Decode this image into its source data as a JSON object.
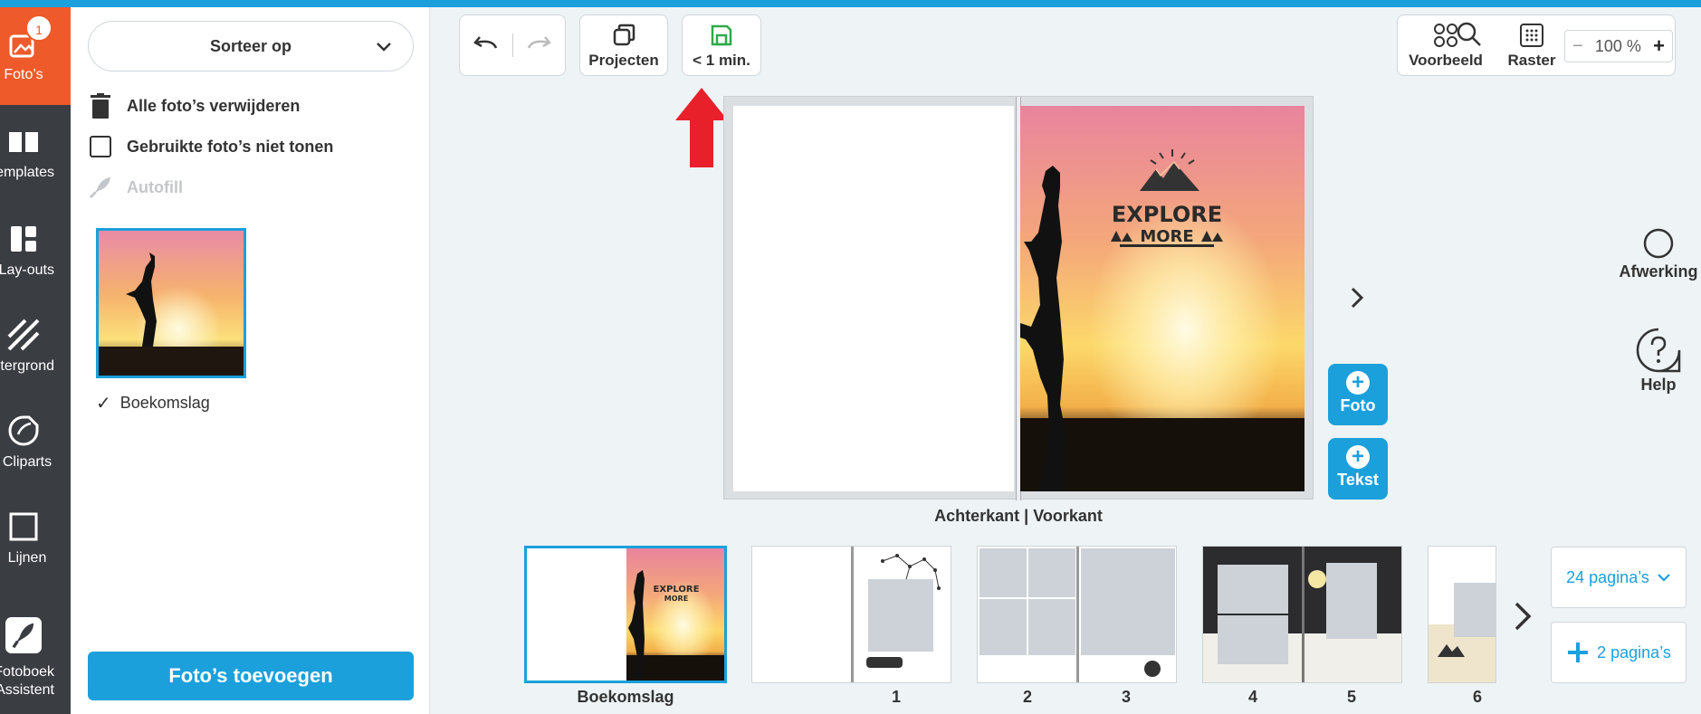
{
  "rail": {
    "items": [
      {
        "label": "Foto’s",
        "badge": "1"
      },
      {
        "label": "Templates"
      },
      {
        "label": "Lay-outs"
      },
      {
        "label": "Achtergrond"
      },
      {
        "label": "Cliparts"
      },
      {
        "label": "Lijnen"
      },
      {
        "label": "Fotoboek",
        "label2": "Assistent"
      }
    ]
  },
  "panel": {
    "sort_label": "Sorteer op",
    "delete_all": "Alle foto’s verwijderen",
    "hide_used": "Gebruikte foto’s niet tonen",
    "autofill": "Autofill",
    "photo_caption": "Boekomslag",
    "add_photos": "Foto’s toevoegen"
  },
  "toolbar": {
    "projects": "Projecten",
    "save_status": "< 1 min.",
    "preview": "Voorbeeld",
    "grid": "Raster",
    "zoom_minus": "−",
    "zoom": "100 %",
    "zoom_plus": "+"
  },
  "canvas": {
    "spread_label": "Achterkant | Voorkant",
    "cover_text_1": "EXPLORE",
    "cover_text_2": "MORE",
    "add_photo": "Foto",
    "add_text": "Tekst"
  },
  "side_tools": {
    "finishing": "Afwerking",
    "help": "Help"
  },
  "filmstrip": {
    "labels": [
      "Boekomslag",
      "1",
      "2",
      "3",
      "4",
      "5",
      "6"
    ],
    "pages_count": "24 pagina’s",
    "add_pages": "2 pagina’s"
  },
  "colors": {
    "accent": "#1ba0dc",
    "active_tab": "#ee5a2a",
    "rail": "#3a3d42",
    "arrow": "#e8202a"
  }
}
